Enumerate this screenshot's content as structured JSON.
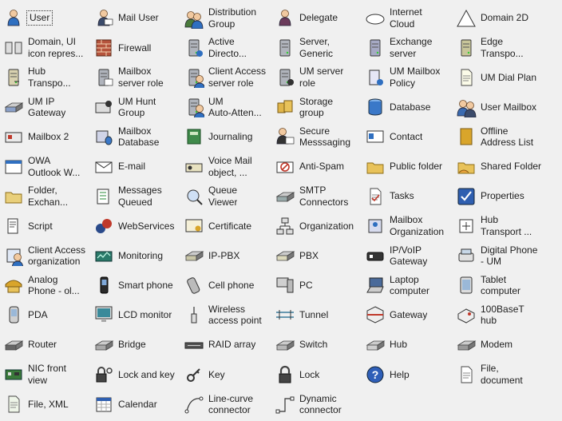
{
  "stencil": {
    "shapes": [
      {
        "label": "User",
        "icon": "user-icon",
        "col": 1,
        "row": 1,
        "selected": true
      },
      {
        "label": "Mail User",
        "icon": "mail-user-icon",
        "col": 2,
        "row": 1
      },
      {
        "label": "Distribution\nGroup",
        "icon": "distribution-group-icon",
        "col": 3,
        "row": 1
      },
      {
        "label": "Delegate",
        "icon": "delegate-icon",
        "col": 4,
        "row": 1
      },
      {
        "label": "Internet\nCloud",
        "icon": "internet-cloud-icon",
        "col": 5,
        "row": 1
      },
      {
        "label": "Domain 2D",
        "icon": "domain-2d-icon",
        "col": 6,
        "row": 1
      },
      {
        "label": "Domain, UI\nicon repres...",
        "icon": "domain-ui-icon",
        "col": 1,
        "row": 2
      },
      {
        "label": "Firewall",
        "icon": "firewall-icon",
        "col": 2,
        "row": 2
      },
      {
        "label": "Active\nDirecto...",
        "icon": "active-directory-icon",
        "col": 3,
        "row": 2
      },
      {
        "label": "Server,\nGeneric",
        "icon": "generic-server-icon",
        "col": 4,
        "row": 2
      },
      {
        "label": "Exchange\nserver",
        "icon": "exchange-server-icon",
        "col": 5,
        "row": 2
      },
      {
        "label": "Edge\nTranspo...",
        "icon": "edge-transport-icon",
        "col": 6,
        "row": 2
      },
      {
        "label": "Hub\nTranspo...",
        "icon": "hub-transport-icon",
        "col": 1,
        "row": 3
      },
      {
        "label": "Mailbox\nserver role",
        "icon": "mailbox-server-role-icon",
        "col": 2,
        "row": 3
      },
      {
        "label": "Client Access\nserver role",
        "icon": "client-access-server-role-icon",
        "col": 3,
        "row": 3
      },
      {
        "label": "UM server\nrole",
        "icon": "um-server-role-icon",
        "col": 4,
        "row": 3
      },
      {
        "label": "UM Mailbox\nPolicy",
        "icon": "um-mailbox-policy-icon",
        "col": 5,
        "row": 3
      },
      {
        "label": "UM Dial Plan",
        "icon": "um-dial-plan-icon",
        "col": 6,
        "row": 3
      },
      {
        "label": "UM IP\nGateway",
        "icon": "um-ip-gateway-icon",
        "col": 1,
        "row": 4
      },
      {
        "label": "UM Hunt\nGroup",
        "icon": "um-hunt-group-icon",
        "col": 2,
        "row": 4
      },
      {
        "label": "UM\nAuto-Atten...",
        "icon": "um-auto-attendant-icon",
        "col": 3,
        "row": 4
      },
      {
        "label": "Storage\ngroup",
        "icon": "storage-group-icon",
        "col": 4,
        "row": 4
      },
      {
        "label": "Database",
        "icon": "database-icon",
        "col": 5,
        "row": 4
      },
      {
        "label": "User Mailbox",
        "icon": "user-mailbox-icon",
        "col": 6,
        "row": 4
      },
      {
        "label": "Mailbox 2",
        "icon": "mailbox-2-icon",
        "col": 1,
        "row": 5
      },
      {
        "label": "Mailbox\nDatabase",
        "icon": "mailbox-database-icon",
        "col": 2,
        "row": 5
      },
      {
        "label": "Journaling",
        "icon": "journaling-icon",
        "col": 3,
        "row": 5
      },
      {
        "label": "Secure\nMesssaging",
        "icon": "secure-messaging-icon",
        "col": 4,
        "row": 5
      },
      {
        "label": "Contact",
        "icon": "contact-icon",
        "col": 5,
        "row": 5
      },
      {
        "label": "Offline\nAddress List",
        "icon": "offline-address-list-icon",
        "col": 6,
        "row": 5
      },
      {
        "label": "OWA\nOutlook W...",
        "icon": "owa-icon",
        "col": 1,
        "row": 6
      },
      {
        "label": "E-mail",
        "icon": "email-icon",
        "col": 2,
        "row": 6
      },
      {
        "label": "Voice Mail\nobject, ...",
        "icon": "voice-mail-icon",
        "col": 3,
        "row": 6
      },
      {
        "label": "Anti-Spam",
        "icon": "anti-spam-icon",
        "col": 4,
        "row": 6
      },
      {
        "label": "Public folder",
        "icon": "public-folder-icon",
        "col": 5,
        "row": 6
      },
      {
        "label": "Shared Folder",
        "icon": "shared-folder-icon",
        "col": 6,
        "row": 6
      },
      {
        "label": "Folder,\nExchan...",
        "icon": "exchange-folder-icon",
        "col": 1,
        "row": 7
      },
      {
        "label": "Messages\nQueued",
        "icon": "messages-queued-icon",
        "col": 2,
        "row": 7
      },
      {
        "label": "Queue\nViewer",
        "icon": "queue-viewer-icon",
        "col": 3,
        "row": 7
      },
      {
        "label": "SMTP\nConnectors",
        "icon": "smtp-connectors-icon",
        "col": 4,
        "row": 7
      },
      {
        "label": "Tasks",
        "icon": "tasks-icon",
        "col": 5,
        "row": 7
      },
      {
        "label": "Properties",
        "icon": "properties-icon",
        "col": 6,
        "row": 7
      },
      {
        "label": "Script",
        "icon": "script-icon",
        "col": 1,
        "row": 8
      },
      {
        "label": "WebServices",
        "icon": "web-services-icon",
        "col": 2,
        "row": 8
      },
      {
        "label": "Certificate",
        "icon": "certificate-icon",
        "col": 3,
        "row": 8
      },
      {
        "label": "Organization",
        "icon": "organization-icon",
        "col": 4,
        "row": 8
      },
      {
        "label": "Mailbox\nOrganization",
        "icon": "mailbox-organization-icon",
        "col": 5,
        "row": 8
      },
      {
        "label": "Hub\nTransport ...",
        "icon": "hub-transport-org-icon",
        "col": 6,
        "row": 8
      },
      {
        "label": "Client Access\norganization",
        "icon": "client-access-organization-icon",
        "col": 1,
        "row": 9
      },
      {
        "label": "Monitoring",
        "icon": "monitoring-icon",
        "col": 2,
        "row": 9
      },
      {
        "label": "IP-PBX",
        "icon": "ip-pbx-icon",
        "col": 3,
        "row": 9
      },
      {
        "label": "PBX",
        "icon": "pbx-icon",
        "col": 4,
        "row": 9
      },
      {
        "label": "IP/VoIP\nGateway",
        "icon": "ip-voip-gateway-icon",
        "col": 5,
        "row": 9
      },
      {
        "label": "Digital Phone\n- UM",
        "icon": "digital-phone-icon",
        "col": 6,
        "row": 9
      },
      {
        "label": "Analog\nPhone - ol...",
        "icon": "analog-phone-icon",
        "col": 1,
        "row": 10
      },
      {
        "label": "Smart phone",
        "icon": "smart-phone-icon",
        "col": 2,
        "row": 10
      },
      {
        "label": "Cell phone",
        "icon": "cell-phone-icon",
        "col": 3,
        "row": 10
      },
      {
        "label": "PC",
        "icon": "pc-icon",
        "col": 4,
        "row": 10
      },
      {
        "label": "Laptop\ncomputer",
        "icon": "laptop-icon",
        "col": 5,
        "row": 10
      },
      {
        "label": "Tablet\ncomputer",
        "icon": "tablet-icon",
        "col": 6,
        "row": 10
      },
      {
        "label": "PDA",
        "icon": "pda-icon",
        "col": 1,
        "row": 11
      },
      {
        "label": "LCD monitor",
        "icon": "lcd-monitor-icon",
        "col": 2,
        "row": 11
      },
      {
        "label": "Wireless\naccess point",
        "icon": "wireless-access-point-icon",
        "col": 3,
        "row": 11
      },
      {
        "label": "Tunnel",
        "icon": "tunnel-icon",
        "col": 4,
        "row": 11
      },
      {
        "label": "Gateway",
        "icon": "gateway-icon",
        "col": 5,
        "row": 11
      },
      {
        "label": "100BaseT\nhub",
        "icon": "100baset-hub-icon",
        "col": 6,
        "row": 11
      },
      {
        "label": "Router",
        "icon": "router-icon",
        "col": 1,
        "row": 12
      },
      {
        "label": "Bridge",
        "icon": "bridge-icon",
        "col": 2,
        "row": 12
      },
      {
        "label": "RAID array",
        "icon": "raid-array-icon",
        "col": 3,
        "row": 12
      },
      {
        "label": "Switch",
        "icon": "switch-icon",
        "col": 4,
        "row": 12
      },
      {
        "label": "Hub",
        "icon": "hub-icon",
        "col": 5,
        "row": 12
      },
      {
        "label": "Modem",
        "icon": "modem-icon",
        "col": 6,
        "row": 12
      },
      {
        "label": "NIC front\nview",
        "icon": "nic-icon",
        "col": 1,
        "row": 13
      },
      {
        "label": "Lock and key",
        "icon": "lock-and-key-icon",
        "col": 2,
        "row": 13
      },
      {
        "label": "Key",
        "icon": "key-icon",
        "col": 3,
        "row": 13
      },
      {
        "label": "Lock",
        "icon": "lock-icon",
        "col": 4,
        "row": 13
      },
      {
        "label": "Help",
        "icon": "help-icon",
        "col": 5,
        "row": 13
      },
      {
        "label": "File,\ndocument",
        "icon": "file-document-icon",
        "col": 6,
        "row": 13
      },
      {
        "label": "File, XML",
        "icon": "file-xml-icon",
        "col": 1,
        "row": 14
      },
      {
        "label": "Calendar",
        "icon": "calendar-icon",
        "col": 2,
        "row": 14
      },
      {
        "label": "Line-curve\nconnector",
        "icon": "line-curve-connector-icon",
        "col": 3,
        "row": 14
      },
      {
        "label": "Dynamic\nconnector",
        "icon": "dynamic-connector-icon",
        "col": 4,
        "row": 14
      }
    ]
  },
  "colors": {
    "background": "#f0f0f0",
    "text": "#1e1e1e",
    "accent_blue": "#2f6fc0",
    "accent_gold": "#d9a52b",
    "accent_red": "#c0392b",
    "gray_device": "#8a8a8a"
  }
}
